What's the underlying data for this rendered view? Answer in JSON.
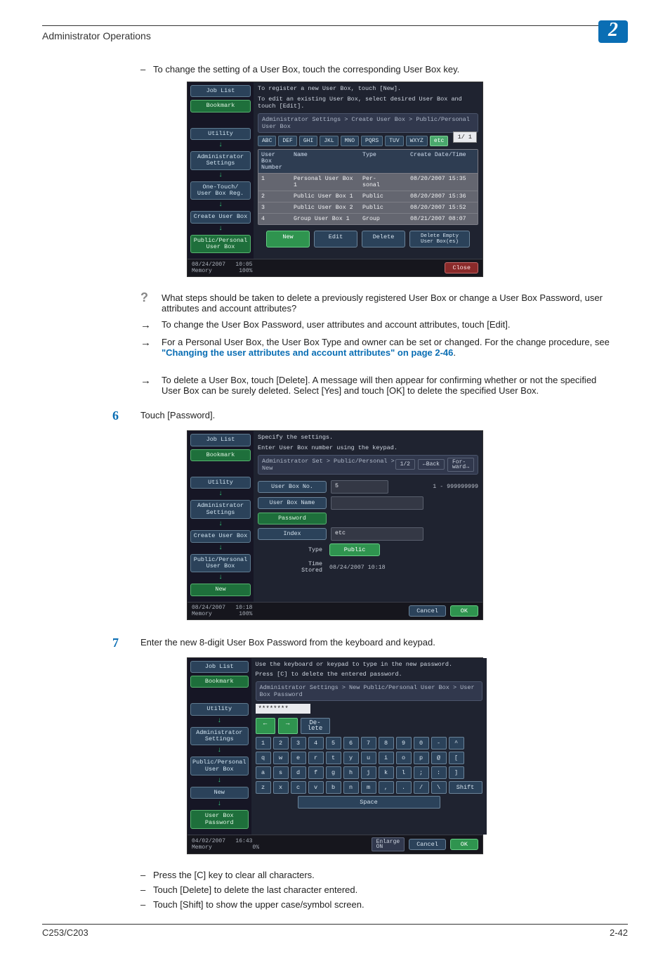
{
  "header": {
    "title": "Administrator Operations",
    "context": "2"
  },
  "intro_dash": "To change the setting of a User Box, touch the corresponding User Box key.",
  "screen1": {
    "sidebar": {
      "job_list": "Job List",
      "bookmark": "Bookmark",
      "utility": "Utility",
      "admin": "Administrator\nSettings",
      "onetouch": "One-Touch/\nUser Box Reg.",
      "create": "Create User Box",
      "pp": "Public/Personal\nUser Box"
    },
    "msg_l1": "To register a new User Box, touch [New].",
    "msg_l2": "To edit an existing User Box, select desired User Box and touch [Edit].",
    "breadcrumb": "Administrator Settings > Create User Box > Public/Personal User Box",
    "tabs": [
      "ABC",
      "DEF",
      "GHI",
      "JKL",
      "MNO",
      "PQRS",
      "TUV",
      "WXYZ",
      "etc"
    ],
    "thead": {
      "no": "User Box\nNumber",
      "name": "Name",
      "type": "Type",
      "date": "Create Date/Time"
    },
    "rows": [
      {
        "no": "1",
        "name": "Personal User Box 1",
        "type": "Per-\nsonal",
        "date": "08/20/2007 15:35"
      },
      {
        "no": "2",
        "name": "Public User Box 1",
        "type": "Public",
        "date": "08/20/2007 15:36"
      },
      {
        "no": "3",
        "name": "Public User Box 2",
        "type": "Public",
        "date": "08/20/2007 15:52"
      },
      {
        "no": "4",
        "name": "Group User Box 1",
        "type": "Group",
        "date": "08/21/2007 08:07"
      }
    ],
    "pager": "1/ 1",
    "buttons": {
      "new": "New",
      "edit": "Edit",
      "delete": "Delete",
      "del_empty": "Delete Empty\nUser Box(es)"
    },
    "footer": {
      "date": "08/24/2007",
      "time": "10:05",
      "mem": "Memory",
      "pct": "100%",
      "close": "Close"
    }
  },
  "qa": {
    "question": "What steps should be taken to delete a previously registered User Box or change a User Box Password, user attributes and account attributes?",
    "a1": "To change the User Box Password, user attributes and account attributes, touch [Edit].",
    "a2_pre": "For a Personal User Box, the User Box Type and owner can be set or changed. For the change procedure, see ",
    "a2_link": "\"Changing the user attributes and account attributes\" on page 2-46",
    "a2_post": ".",
    "a3": "To delete a User Box, touch [Delete]. A message will then appear for confirming whether or not the specified User Box can be surely deleted. Select [Yes] and touch [OK] to delete the specified User Box."
  },
  "step6": {
    "num": "6",
    "text": "Touch [Password]."
  },
  "screen2": {
    "sidebar": {
      "job_list": "Job List",
      "bookmark": "Bookmark",
      "utility": "Utility",
      "admin": "Administrator\nSettings",
      "create": "Create User Box",
      "pp": "Public/Personal\nUser Box",
      "new": "New"
    },
    "msg_l1": "Specify the settings.",
    "msg_l2": "Enter User Box number using the keypad.",
    "breadcrumb": "Administrator Set > Public/Personal > New",
    "page_ind": "1/2",
    "back": "Back",
    "fwd": "For-\nward",
    "rows": {
      "no_label": "User Box No.",
      "no_val": "5",
      "no_hint": "1 - 999999999",
      "name_label": "User Box Name",
      "pwd_label": "Password",
      "index_label": "Index",
      "index_val": "etc",
      "type_label": "Type",
      "type_val": "Public",
      "stored_label": "Time\nStored",
      "stored_val": "08/24/2007  10:18"
    },
    "footer": {
      "date": "08/24/2007",
      "time": "10:18",
      "mem": "Memory",
      "pct": "100%",
      "cancel": "Cancel",
      "ok": "OK"
    }
  },
  "step7": {
    "num": "7",
    "text": "Enter the new 8-digit User Box Password from the keyboard and keypad."
  },
  "screen3": {
    "sidebar": {
      "job_list": "Job List",
      "bookmark": "Bookmark",
      "utility": "Utility",
      "admin": "Administrator\nSettings",
      "pp": "Public/Personal\nUser Box",
      "new": "New",
      "pwd": "User Box\nPassword"
    },
    "msg_l1": "Use the keyboard or keypad to type in the new password.",
    "msg_l2": "Press [C] to delete the entered password.",
    "breadcrumb": "Administrator Settings > New Public/Personal User Box > User Box Password",
    "pwd_masked": "********",
    "controls": {
      "left": "←",
      "right": "→",
      "del": "De-\nlete"
    },
    "kb": {
      "r1": [
        "1",
        "2",
        "3",
        "4",
        "5",
        "6",
        "7",
        "8",
        "9",
        "0",
        "-",
        "^"
      ],
      "r2": [
        "q",
        "w",
        "e",
        "r",
        "t",
        "y",
        "u",
        "i",
        "o",
        "p",
        "@",
        "["
      ],
      "r3": [
        "a",
        "s",
        "d",
        "f",
        "g",
        "h",
        "j",
        "k",
        "l",
        ";",
        ":",
        "]"
      ],
      "r4": [
        "z",
        "x",
        "c",
        "v",
        "b",
        "n",
        "m",
        ",",
        ".",
        "/",
        "\\"
      ],
      "shift": "Shift",
      "space": "Space"
    },
    "enlarge": "Enlarge\nON",
    "footer": {
      "date": "04/02/2007",
      "time": "16:43",
      "mem": "Memory",
      "pct": "0%",
      "cancel": "Cancel",
      "ok": "OK"
    }
  },
  "notes": {
    "n1": "Press the [C] key to clear all characters.",
    "n2": "Touch [Delete] to delete the last character entered.",
    "n3": "Touch [Shift] to show the upper case/symbol screen."
  },
  "footer": {
    "left": "C253/C203",
    "right": "2-42"
  }
}
